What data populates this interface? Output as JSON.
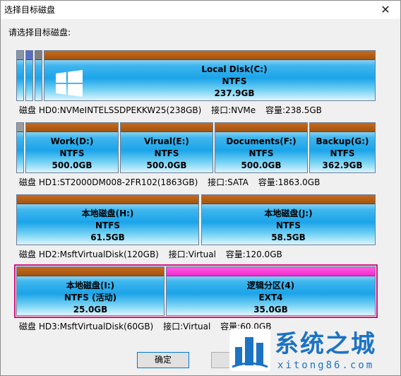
{
  "window": {
    "title": "选择目标磁盘",
    "close_glyph": "✕"
  },
  "prompt": "请选择目标磁盘:",
  "disks": [
    {
      "info": [
        "磁盘 HD0:NVMeINTELSSDPEKKW25(238GB)",
        "接口:NVMe",
        "容量:238.5GB"
      ],
      "partitions": [
        {
          "name": "Local Disk(C:)",
          "fs": "NTFS",
          "size": "237.9GB"
        }
      ]
    },
    {
      "info": [
        "磁盘 HD1:ST2000DM008-2FR102(1863GB)",
        "接口:SATA",
        "容量:1863.0GB"
      ],
      "partitions": [
        {
          "name": "Work(D:)",
          "fs": "NTFS",
          "size": "500.0GB"
        },
        {
          "name": "Virual(E:)",
          "fs": "NTFS",
          "size": "500.0GB"
        },
        {
          "name": "Documents(F:)",
          "fs": "NTFS",
          "size": "500.0GB"
        },
        {
          "name": "Backup(G:)",
          "fs": "NTFS",
          "size": "362.9GB"
        }
      ]
    },
    {
      "info": [
        "磁盘 HD2:MsftVirtualDisk(120GB)",
        "接口:Virtual",
        "容量:120.0GB"
      ],
      "partitions": [
        {
          "name": "本地磁盘(H:)",
          "fs": "NTFS",
          "size": "61.5GB"
        },
        {
          "name": "本地磁盘(J:)",
          "fs": "NTFS",
          "size": "58.5GB"
        }
      ]
    },
    {
      "info": [
        "磁盘 HD3:MsftVirtualDisk(60GB)",
        "接口:Virtual",
        "容量:60.0GB"
      ],
      "partitions": [
        {
          "name": "本地磁盘(I:)",
          "fs": "NTFS (活动)",
          "size": "25.0GB"
        },
        {
          "name": "逻辑分区(4)",
          "fs": "EXT4",
          "size": "35.0GB"
        }
      ]
    }
  ],
  "buttons": {
    "ok": "确定"
  },
  "watermark": {
    "text": "系统之城",
    "url": "xitong86.com"
  },
  "colors": {
    "selected_border": "#d61280",
    "logical_cap": "#ff3fd6",
    "partition_cap": "#b05b14"
  }
}
